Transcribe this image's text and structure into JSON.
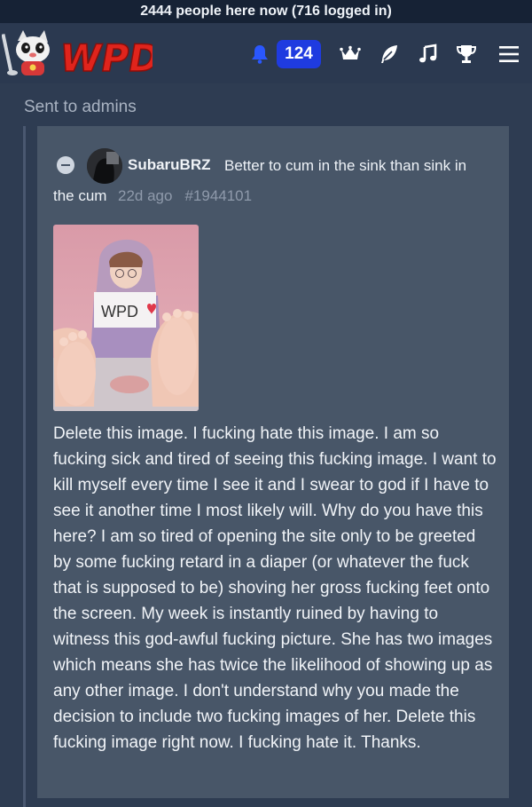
{
  "topbar": {
    "online_text": "2444 people here now (716 logged in)"
  },
  "header": {
    "logo_text": "WPD",
    "notification_count": "124",
    "icons": [
      "bell-icon",
      "crown-icon",
      "feather-icon",
      "music-note-icon",
      "trophy-icon",
      "menu-icon"
    ],
    "accent_color": "#1f3be0"
  },
  "section": {
    "title": "Sent to admins"
  },
  "comment": {
    "username": "SubaruBRZ",
    "flair_line1": "Better to cum in the sink than sink in",
    "flair_line2": "the cum",
    "age": "22d ago",
    "id": "#1944101",
    "image_sign_text": "WPD",
    "body": "Delete this image. I fucking hate this image. I am so fucking sick and tired of seeing this fucking image. I want to kill myself every time I see it and I swear to god if I have to see it another time I most likely will. Why do you have this here? I am so tired of opening the site only to be greeted by some fucking retard in a diaper (or whatever the fuck that is supposed to be) shoving her gross fucking feet onto the screen. My week is instantly ruined by having to witness this god-awful fucking picture. She has two images which means she has twice the likelihood of showing up as any other image. I don't understand why you made the decision to include two fucking images of her. Delete this fucking image right now. I fucking hate it. Thanks."
  }
}
